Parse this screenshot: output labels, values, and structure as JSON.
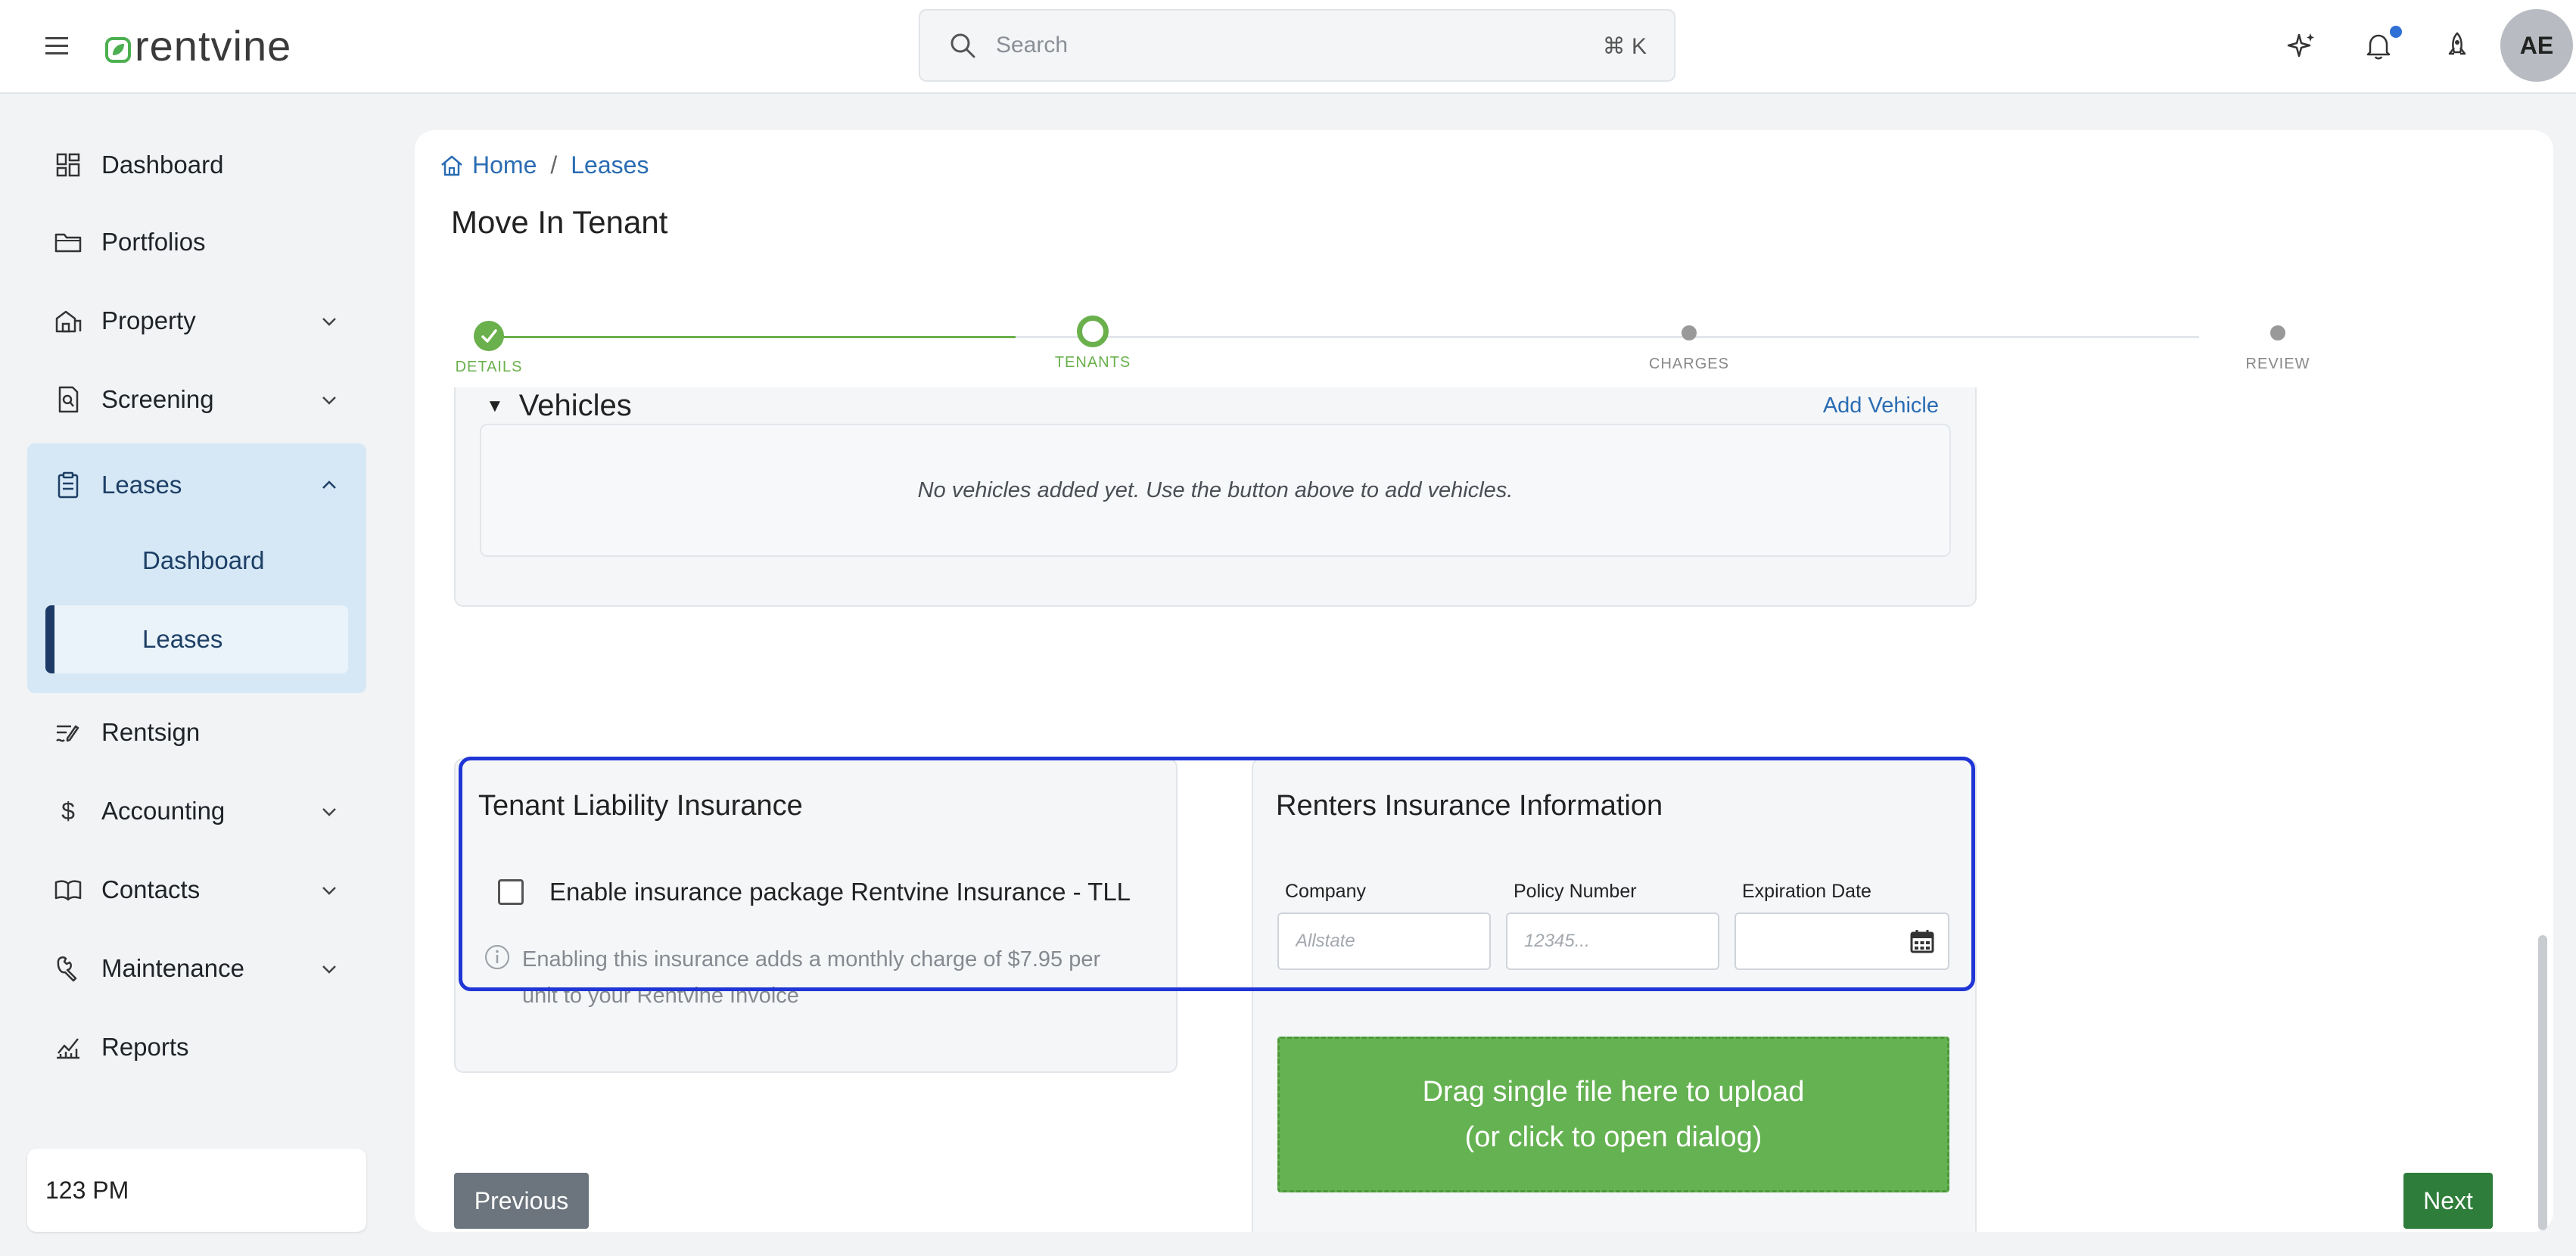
{
  "header": {
    "brand": "rentvine",
    "search_placeholder": "Search",
    "search_shortcut": "⌘ K",
    "avatar_initials": "AE"
  },
  "sidebar": {
    "items": [
      {
        "label": "Dashboard",
        "icon": "dashboard-icon",
        "expandable": false
      },
      {
        "label": "Portfolios",
        "icon": "folder-icon",
        "expandable": false
      },
      {
        "label": "Property",
        "icon": "building-icon",
        "expandable": true
      },
      {
        "label": "Screening",
        "icon": "screening-icon",
        "expandable": true
      },
      {
        "label": "Leases",
        "icon": "clipboard-icon",
        "expandable": true,
        "expanded": true
      },
      {
        "label": "Rentsign",
        "icon": "rentsign-icon",
        "expandable": false
      },
      {
        "label": "Accounting",
        "icon": "dollar-icon",
        "expandable": true
      },
      {
        "label": "Contacts",
        "icon": "book-icon",
        "expandable": true
      },
      {
        "label": "Maintenance",
        "icon": "wrench-icon",
        "expandable": true
      },
      {
        "label": "Reports",
        "icon": "chart-icon",
        "expandable": false
      }
    ],
    "leases_sub": [
      {
        "label": "Dashboard",
        "active": false
      },
      {
        "label": "Leases",
        "active": true
      }
    ],
    "time": "123 PM"
  },
  "breadcrumb": [
    "Home",
    "Leases"
  ],
  "page_title": "Move In Tenant",
  "stepper": {
    "steps": [
      "DETAILS",
      "TENANTS",
      "CHARGES",
      "REVIEW"
    ],
    "current_index": 1
  },
  "vehicles": {
    "title": "Vehicles",
    "add_label": "Add Vehicle",
    "empty_text": "No vehicles added yet. Use the button above to add vehicles."
  },
  "tenant_liability": {
    "title": "Tenant Liability Insurance",
    "checkbox_label": "Enable insurance package Rentvine Insurance - TLL",
    "checked": false,
    "info_line1": "Enabling this insurance adds a monthly charge of $7.95 per",
    "info_line2": "unit to your Rentvine Invoice"
  },
  "renters_insurance": {
    "title": "Renters Insurance Information",
    "company_label": "Company",
    "company_placeholder": "Allstate",
    "company_value": "",
    "policy_label": "Policy Number",
    "policy_placeholder": "12345...",
    "policy_value": "",
    "expiration_label": "Expiration Date",
    "expiration_value": "",
    "dropzone_line1": "Drag single file here to upload",
    "dropzone_line2": "(or click to open dialog)"
  },
  "buttons": {
    "previous": "Previous",
    "next": "Next"
  },
  "colors": {
    "brand_green": "#4caf50",
    "step_done": "#6ab04c",
    "highlight_blue": "#1f35d6",
    "dropzone_green": "#65b252",
    "next_button": "#2e7d3a",
    "prev_button": "#6c757d",
    "link_blue": "#2a6cb3",
    "notification_dot": "#2f6fd6"
  }
}
